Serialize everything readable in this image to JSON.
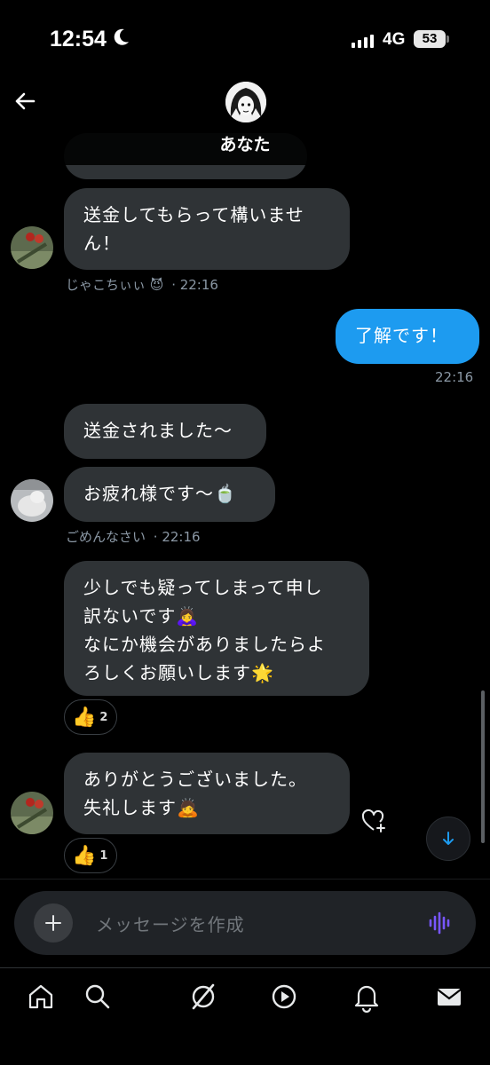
{
  "status_bar": {
    "time": "12:54",
    "network": "4G",
    "battery": "53"
  },
  "header": {
    "back_icon": "arrow-left-icon",
    "contact_name": "あなた"
  },
  "messages": {
    "m1": {
      "text": "送金してもらって構いませ\nん！"
    },
    "m1_meta": {
      "sender": "じゃこちぃぃ 😈",
      "time": "· 22:16"
    },
    "m2": {
      "text": "了解です！"
    },
    "m2_meta": {
      "time": "22:16"
    },
    "m3": {
      "text": "送金されました〜"
    },
    "m4": {
      "text": "お疲れ様です〜🍵"
    },
    "m4_meta": {
      "sender": "ごめんなさい",
      "time": "· 22:16"
    },
    "m5": {
      "text": "少しでも疑ってしまって申し\n訳ないです🙇‍♀️\nなにか機会がありましたらよ\nろしくお願いします🌟"
    },
    "m5_reaction": {
      "emoji": "👍",
      "count": "2"
    },
    "m6": {
      "text": "ありがとうございました。\n失礼します🙇"
    },
    "m6_reaction": {
      "emoji": "👍",
      "count": "1"
    }
  },
  "composer": {
    "placeholder": "メッセージを作成"
  },
  "tabs": [
    "home-icon",
    "search-icon",
    "grok-icon",
    "video-icon",
    "notifications-icon",
    "messages-icon"
  ],
  "colors": {
    "background": "#000000",
    "bubble_incoming": "#2f3336",
    "bubble_outgoing": "#1d9bf0",
    "meta_text": "#8b98a5",
    "voice_accent": "#7856ff"
  }
}
